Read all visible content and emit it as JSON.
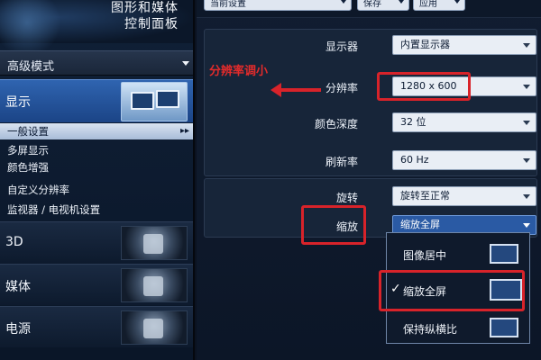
{
  "header": {
    "title_line1": "图形和媒体",
    "title_line2": "控制面板"
  },
  "mode_select": {
    "label": "高级模式"
  },
  "categories": {
    "display": "显示",
    "d3": "3D",
    "media": "媒体",
    "power": "电源"
  },
  "sub_items": [
    "一般设置",
    "多屏显示",
    "颜色增强",
    "自定义分辨率",
    "监视器 / 电视机设置"
  ],
  "sub_item_arrow": "▸▸",
  "top_strip": {
    "scheme": "当前设置",
    "save": "保存",
    "apply": "应用"
  },
  "settings": {
    "display_label": "显示器",
    "display_value": "内置显示器",
    "resolution_label": "分辨率",
    "resolution_value": "1280 x 600",
    "color_depth_label": "颜色深度",
    "color_depth_value": "32 位",
    "refresh_label": "刷新率",
    "refresh_value": "60 Hz",
    "rotation_label": "旋转",
    "rotation_value": "旋转至正常",
    "scaling_label": "缩放",
    "scaling_value": "缩放全屏"
  },
  "annotation": {
    "text": "分辨率调小"
  },
  "scaling_options": [
    {
      "label": "图像居中",
      "checked": false
    },
    {
      "label": "缩放全屏",
      "checked": true
    },
    {
      "label": "保持纵横比",
      "checked": false
    }
  ],
  "check_mark": "✓",
  "colors": {
    "highlight": "#d8232a",
    "selected_category": "#2f64b0",
    "annotation_text": "#e32b2b"
  }
}
